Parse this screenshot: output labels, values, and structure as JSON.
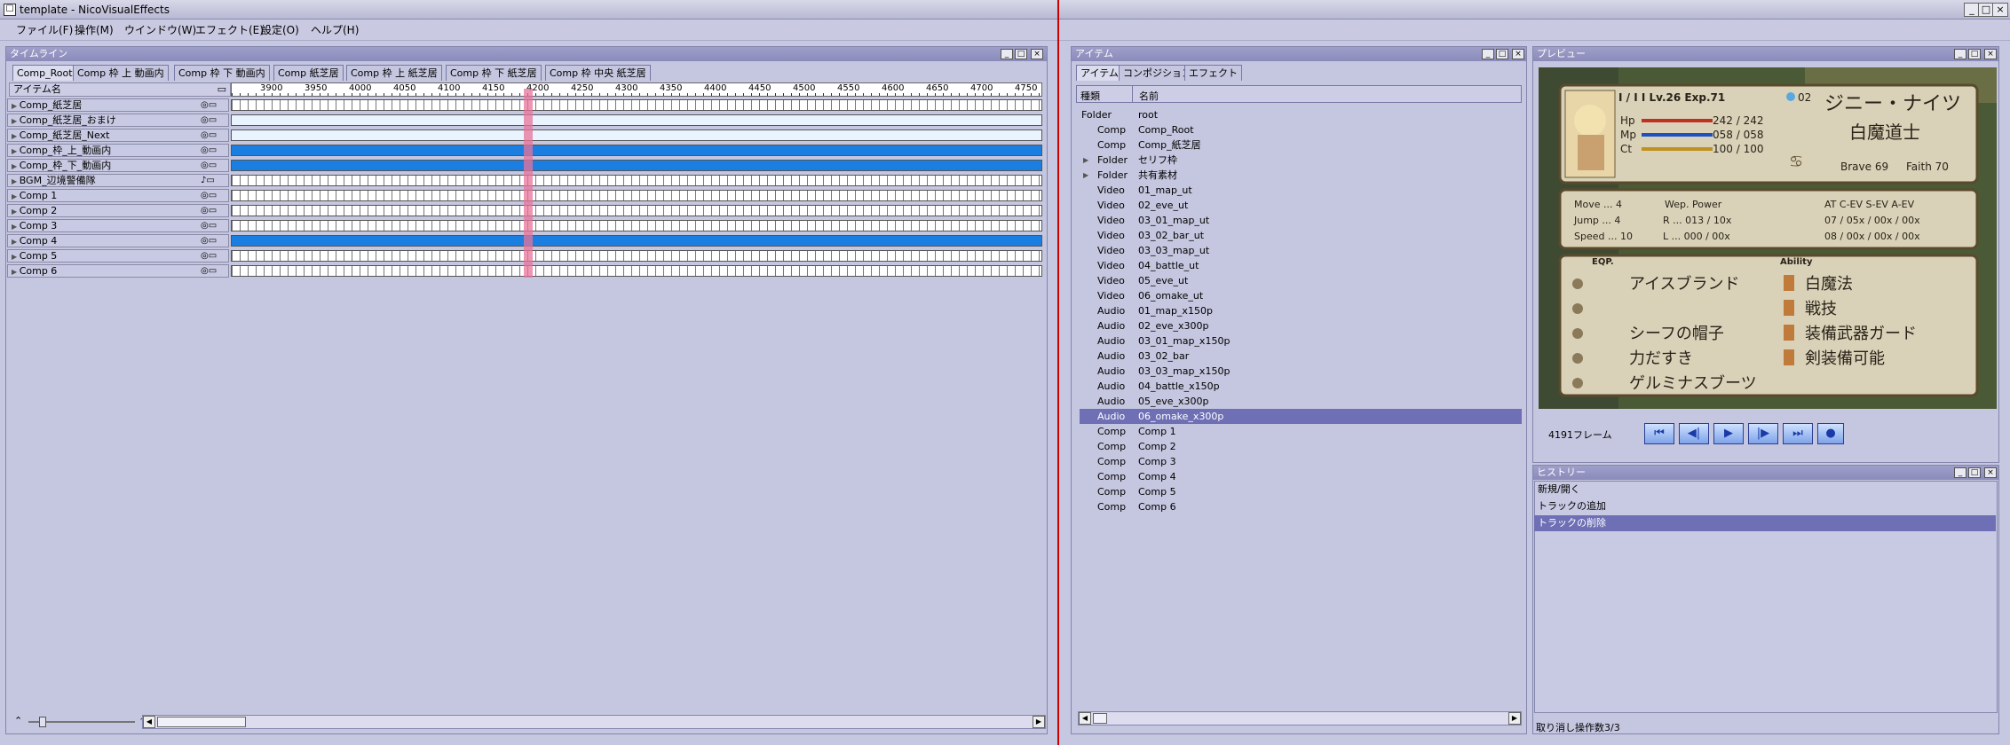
{
  "window": {
    "title": "template - NicoVisualEffects",
    "icon": "window-icon"
  },
  "menu": [
    "ファイル(F)",
    "操作(M)",
    "ウインドウ(W)",
    "エフェクト(E)",
    "設定(O)",
    "ヘルプ(H)"
  ],
  "timeline": {
    "title": "タイムライン",
    "tabs": [
      "Comp_Root",
      "Comp 枠 上 動画内",
      "Comp 枠 下 動画内",
      "Comp 紙芝居",
      "Comp 枠 上 紙芝居",
      "Comp 枠 下 紙芝居",
      "Comp 枠 中央 紙芝居"
    ],
    "column_header": "アイテム名",
    "ruler": [
      "3900",
      "3950",
      "4000",
      "4050",
      "4100",
      "4150",
      "4200",
      "4250",
      "4300",
      "4350",
      "4400",
      "4450",
      "4500",
      "4550",
      "4600",
      "4650",
      "4700",
      "4750"
    ],
    "rows": [
      {
        "name": "Comp_紙芝居",
        "track": "cells",
        "icons": "◎▭"
      },
      {
        "name": "Comp_紙芝居_おまけ",
        "track": "pale",
        "icons": "◎▭"
      },
      {
        "name": "Comp_紙芝居_Next",
        "track": "pale",
        "icons": "◎▭"
      },
      {
        "name": "Comp_枠_上_動画内",
        "track": "blue",
        "icons": "◎▭"
      },
      {
        "name": "Comp_枠_下_動画内",
        "track": "blue",
        "icons": "◎▭"
      },
      {
        "name": "BGM_辺境警備隊",
        "track": "cells",
        "icons": "♪▭"
      },
      {
        "name": "Comp 1",
        "track": "cells",
        "icons": "◎▭"
      },
      {
        "name": "Comp 2",
        "track": "cells",
        "icons": "◎▭"
      },
      {
        "name": "Comp 3",
        "track": "cells",
        "icons": "◎▭"
      },
      {
        "name": "Comp 4",
        "track": "blue",
        "icons": "◎▭"
      },
      {
        "name": "Comp 5",
        "track": "cells",
        "icons": "◎▭"
      },
      {
        "name": "Comp 6",
        "track": "cells",
        "icons": "◎▭"
      }
    ]
  },
  "items": {
    "title": "アイテム",
    "tabs": [
      "アイテム",
      "コンポジション",
      "エフェクト"
    ],
    "columns": [
      "種類",
      "名前"
    ],
    "rows": [
      {
        "type": "Folder",
        "name": "root",
        "indent": 0
      },
      {
        "type": "Comp",
        "name": "Comp_Root",
        "indent": 1
      },
      {
        "type": "Comp",
        "name": "Comp_紙芝居",
        "indent": 1
      },
      {
        "type": "Folder",
        "name": "セリフ枠",
        "indent": 1,
        "expand": "▶"
      },
      {
        "type": "Folder",
        "name": "共有素材",
        "indent": 1,
        "expand": "▶"
      },
      {
        "type": "Video",
        "name": "01_map_ut",
        "indent": 1
      },
      {
        "type": "Video",
        "name": "02_eve_ut",
        "indent": 1
      },
      {
        "type": "Video",
        "name": "03_01_map_ut",
        "indent": 1
      },
      {
        "type": "Video",
        "name": "03_02_bar_ut",
        "indent": 1
      },
      {
        "type": "Video",
        "name": "03_03_map_ut",
        "indent": 1
      },
      {
        "type": "Video",
        "name": "04_battle_ut",
        "indent": 1
      },
      {
        "type": "Video",
        "name": "05_eve_ut",
        "indent": 1
      },
      {
        "type": "Video",
        "name": "06_omake_ut",
        "indent": 1
      },
      {
        "type": "Audio",
        "name": "01_map_x150p",
        "indent": 1
      },
      {
        "type": "Audio",
        "name": "02_eve_x300p",
        "indent": 1
      },
      {
        "type": "Audio",
        "name": "03_01_map_x150p",
        "indent": 1
      },
      {
        "type": "Audio",
        "name": "03_02_bar",
        "indent": 1
      },
      {
        "type": "Audio",
        "name": "03_03_map_x150p",
        "indent": 1
      },
      {
        "type": "Audio",
        "name": "04_battle_x150p",
        "indent": 1
      },
      {
        "type": "Audio",
        "name": "05_eve_x300p",
        "indent": 1
      },
      {
        "type": "Audio",
        "name": "06_omake_x300p",
        "indent": 1,
        "selected": true
      },
      {
        "type": "Comp",
        "name": "Comp 1",
        "indent": 1
      },
      {
        "type": "Comp",
        "name": "Comp 2",
        "indent": 1
      },
      {
        "type": "Comp",
        "name": "Comp 3",
        "indent": 1
      },
      {
        "type": "Comp",
        "name": "Comp 4",
        "indent": 1
      },
      {
        "type": "Comp",
        "name": "Comp 5",
        "indent": 1
      },
      {
        "type": "Comp",
        "name": "Comp 6",
        "indent": 1
      }
    ]
  },
  "preview": {
    "title": "プレビュー",
    "frame_label": "4191フレーム",
    "controls": [
      "skip-to-start-icon",
      "step-back-icon",
      "play-icon",
      "step-forward-icon",
      "skip-to-end-icon",
      "record-icon"
    ],
    "game": {
      "header": "I / I I Lv.26 Exp.71",
      "num": "02",
      "name": "ジニー・ナイツ",
      "job": "白魔道士",
      "hp": "Hp",
      "hp_val": "242 / 242",
      "mp": "Mp",
      "mp_val": "058 / 058",
      "ct": "Ct",
      "ct_val": "100 / 100",
      "brave": "Brave 69",
      "faith": "Faith 70",
      "move": "Move ... 4",
      "jump": "Jump ... 4",
      "speed": "Speed ... 10",
      "wep": "Wep. Power",
      "r": "R ... 013 / 10x",
      "l": "L ... 000 / 00x",
      "ev_header": "AT C-EV S-EV A-EV",
      "ev1": "07 / 05x / 00x / 00x",
      "ev2": "08 / 00x / 00x / 00x",
      "eqp": "EQP.",
      "ability": "Ability",
      "equip": [
        "アイスブランド",
        "",
        "シーフの帽子",
        "力だすき",
        "ゲルミナスブーツ"
      ],
      "abilities": [
        "白魔法",
        "戦技",
        "装備武器ガード",
        "剣装備可能"
      ]
    }
  },
  "history": {
    "title": "ヒストリー",
    "items": [
      "新規/開く",
      "トラックの追加",
      "トラックの削除"
    ],
    "selected": 2,
    "status": "取り消し操作数3/3"
  },
  "colors": {
    "accent": "#6e6fb4",
    "track_blue": "#1a7fe0",
    "playhead": "#e8739a",
    "divider": "#cc0000"
  }
}
